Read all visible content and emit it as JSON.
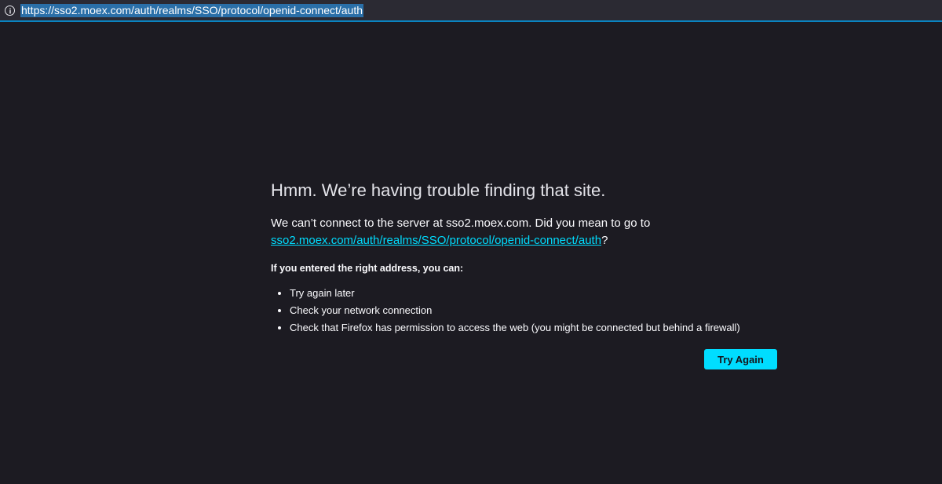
{
  "urlbar": {
    "url": "https://sso2.moex.com/auth/realms/SSO/protocol/openid-connect/auth",
    "icon": "info-icon"
  },
  "error": {
    "title": "Hmm. We’re having trouble finding that site.",
    "desc_prefix": "We can’t connect to the server at sso2.moex.com. Did you mean to go to ",
    "suggested_link": "sso2.moex.com/auth/realms/SSO/protocol/openid-connect/auth",
    "desc_suffix": "?",
    "subhead": "If you entered the right address, you can:",
    "tips": [
      "Try again later",
      "Check your network connection",
      "Check that Firefox has permission to access the web (you might be connected but behind a firewall)"
    ],
    "button_label": "Try Again"
  },
  "colors": {
    "background": "#1c1b22",
    "accent": "#00ddff",
    "url_highlight": "#2a6fa8"
  }
}
